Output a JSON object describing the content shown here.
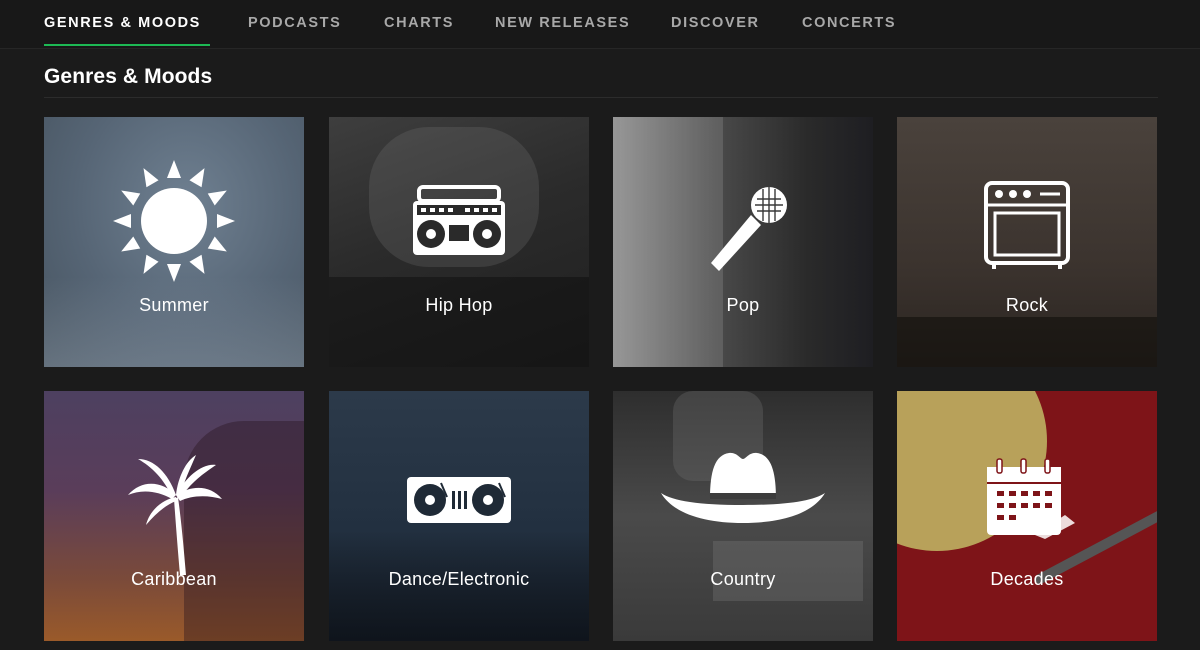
{
  "nav": {
    "tabs": [
      {
        "label": "GENRES & MOODS"
      },
      {
        "label": "PODCASTS"
      },
      {
        "label": "CHARTS"
      },
      {
        "label": "NEW RELEASES"
      },
      {
        "label": "DISCOVER"
      },
      {
        "label": "CONCERTS"
      }
    ],
    "active_tab": "GENRES & MOODS",
    "accent_color": "#1db954"
  },
  "section": {
    "title": "Genres & Moods"
  },
  "tiles": [
    {
      "label": "Summer",
      "icon": "sun-icon",
      "color": "#57677a"
    },
    {
      "label": "Hip Hop",
      "icon": "boombox-icon",
      "color": "#2f2f2f"
    },
    {
      "label": "Pop",
      "icon": "microphone-icon",
      "color": "#3a3a3a"
    },
    {
      "label": "Rock",
      "icon": "amplifier-icon",
      "color": "#3d3632"
    },
    {
      "label": "Caribbean",
      "icon": "palm-tree-icon",
      "color": "#4a3a4a"
    },
    {
      "label": "Dance/Electronic",
      "icon": "turntables-icon",
      "color": "#253140"
    },
    {
      "label": "Country",
      "icon": "cowboy-hat-icon",
      "color": "#3c3c3c"
    },
    {
      "label": "Decades",
      "icon": "calendar-icon",
      "color": "#7e1418"
    }
  ]
}
